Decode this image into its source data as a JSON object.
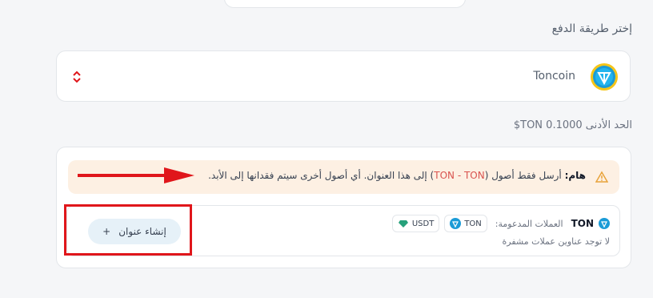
{
  "page": {
    "section_title": "إختر طريقة الدفع",
    "min_amount_label": "الحد الأدنى 0.1000 TON$"
  },
  "payment_method": {
    "name": "Toncoin",
    "icon": "toncoin-logo",
    "accent": "#1a9bd7"
  },
  "warning": {
    "bold": "هام:",
    "text_before": " أرسل فقط أصول (",
    "highlight": "TON - TON",
    "text_after": ") إلى هذا العنوان. أي أصول أخرى سيتم فقدانها إلى الأبد.",
    "icon": "warning-triangle-icon",
    "highlight_color": "#d9534f"
  },
  "address": {
    "coin": "TON",
    "supported_label": "العملات المدعومة:",
    "chips": [
      {
        "label": "TON",
        "icon": "ton-icon"
      },
      {
        "label": "USDT",
        "icon": "usdt-icon"
      }
    ],
    "empty_text": "لا توجد عناوين عملات مشفرة",
    "create_button": "إنشاء عنوان",
    "create_icon": "plus-icon"
  },
  "annotations": {
    "frame_color": "#e0161b"
  }
}
